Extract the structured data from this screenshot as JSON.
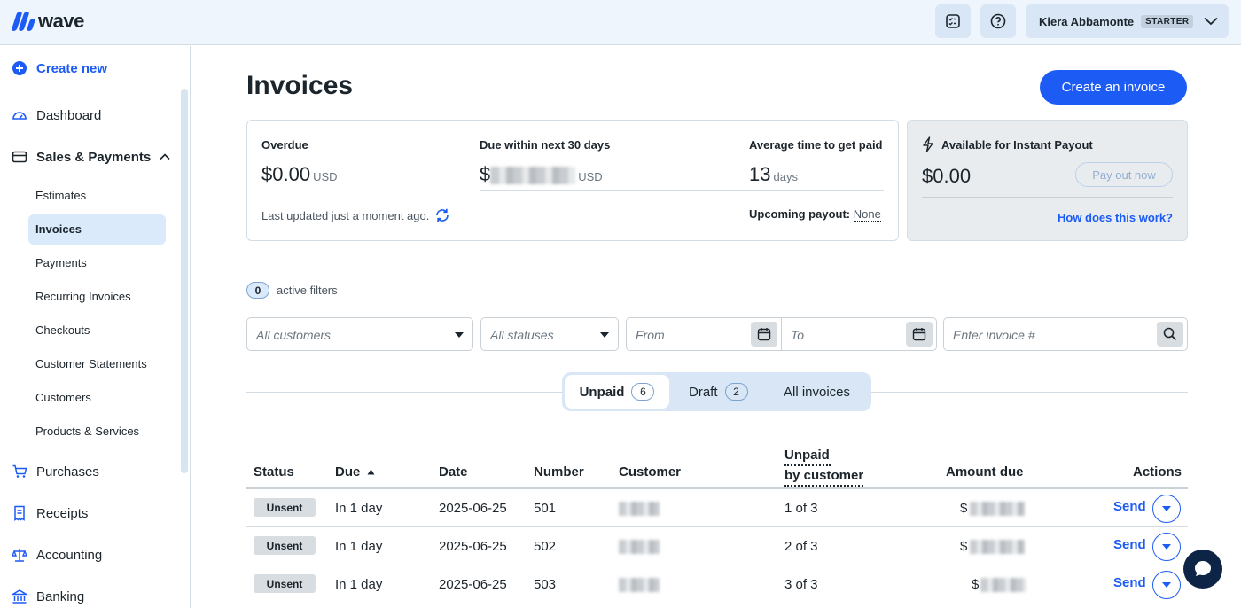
{
  "brand": {
    "name": "wave",
    "accent": "#1c5cf5"
  },
  "topbar": {
    "checklist_icon": "checklist-icon",
    "help_icon": "help-icon",
    "user_name": "Kiera Abbamonte",
    "plan": "STARTER"
  },
  "sidebar": {
    "create_new": "Create new",
    "dashboard": "Dashboard",
    "sales_payments": "Sales & Payments",
    "sub_items": [
      "Estimates",
      "Invoices",
      "Payments",
      "Recurring Invoices",
      "Checkouts",
      "Customer Statements",
      "Customers",
      "Products & Services"
    ],
    "active_item": "Invoices",
    "purchases": "Purchases",
    "receipts": "Receipts",
    "accounting": "Accounting",
    "banking": "Banking"
  },
  "main": {
    "title": "Invoices",
    "create_invoice": "Create an invoice"
  },
  "summary": {
    "overdue_label": "Overdue",
    "overdue_value": "$0.00",
    "overdue_unit": "USD",
    "due_label": "Due within next 30 days",
    "due_prefix": "$",
    "due_unit": "USD",
    "avg_label": "Average time to get paid",
    "avg_value": "13",
    "avg_unit": "days",
    "last_updated": "Last updated just a moment ago.",
    "upcoming_label": "Upcoming payout:",
    "upcoming_value": "None"
  },
  "payout": {
    "label": "Available for Instant Payout",
    "value": "$0.00",
    "button": "Pay out now",
    "link": "How does this work?"
  },
  "filters": {
    "count": "0",
    "label": "active filters",
    "customers_placeholder": "All customers",
    "statuses_placeholder": "All statuses",
    "from_placeholder": "From",
    "to_placeholder": "To",
    "invoice_placeholder": "Enter invoice #"
  },
  "tabs": [
    {
      "label": "Unpaid",
      "count": "6"
    },
    {
      "label": "Draft",
      "count": "2"
    },
    {
      "label": "All invoices"
    }
  ],
  "table": {
    "headers": {
      "status": "Status",
      "due": "Due",
      "date": "Date",
      "number": "Number",
      "customer": "Customer",
      "unpaid_line1": "Unpaid",
      "unpaid_line2": "by customer",
      "amount": "Amount due",
      "actions": "Actions"
    },
    "rows": [
      {
        "status": "Unsent",
        "due": "In 1 day",
        "date": "2025-06-25",
        "number": "501",
        "unpaid": "1 of 3",
        "amount_prefix": "$",
        "action": "Send"
      },
      {
        "status": "Unsent",
        "due": "In 1 day",
        "date": "2025-06-25",
        "number": "502",
        "unpaid": "2 of 3",
        "amount_prefix": "$",
        "action": "Send"
      },
      {
        "status": "Unsent",
        "due": "In 1 day",
        "date": "2025-06-25",
        "number": "503",
        "unpaid": "3 of 3",
        "amount_prefix": "$",
        "action": "Send"
      }
    ]
  }
}
